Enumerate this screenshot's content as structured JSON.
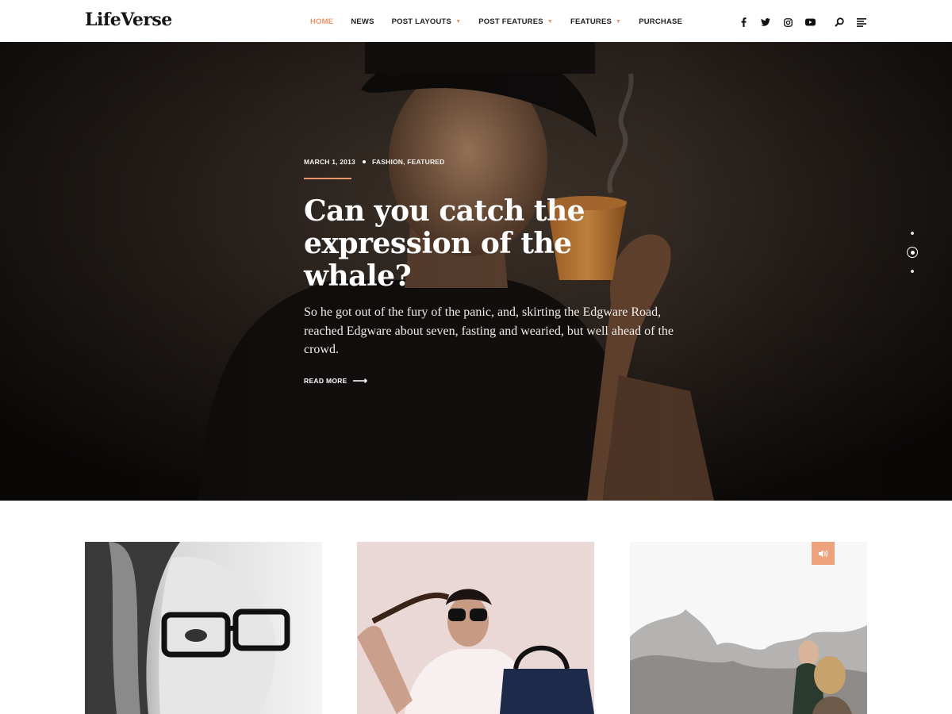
{
  "header": {
    "logo": "LifeVerse",
    "nav": [
      {
        "label": "HOME",
        "active": true,
        "dropdown": false
      },
      {
        "label": "NEWS",
        "active": false,
        "dropdown": false
      },
      {
        "label": "POST LAYOUTS",
        "active": false,
        "dropdown": true
      },
      {
        "label": "POST FEATURES",
        "active": false,
        "dropdown": true
      },
      {
        "label": "FEATURES",
        "active": false,
        "dropdown": true
      },
      {
        "label": "PURCHASE",
        "active": false,
        "dropdown": false
      }
    ],
    "social": [
      "facebook-icon",
      "twitter-icon",
      "instagram-icon",
      "youtube-icon"
    ],
    "tools": [
      "search-icon",
      "menu-icon"
    ]
  },
  "hero": {
    "date": "MARCH 1, 2013",
    "categories": "FASHION, FEATURED",
    "title": "Can you catch the expression of the whale?",
    "excerpt": "So he got out of the fury of the panic, and, skirting the Edgware Road, reached Edgware about seven, fasting and wearied, but well ahead of the crowd.",
    "read_more": "READ MORE",
    "slides_total": 3,
    "active_slide": 2
  },
  "cards": [
    {
      "image": "woman-glasses-bw-photo"
    },
    {
      "image": "woman-sunglasses-handbag-photo"
    },
    {
      "image": "hikers-rocks-photo",
      "badge": "audio-icon"
    }
  ],
  "colors": {
    "accent": "#e8956b",
    "badge": "#eda27c",
    "hero_bg": "#1a1613"
  }
}
